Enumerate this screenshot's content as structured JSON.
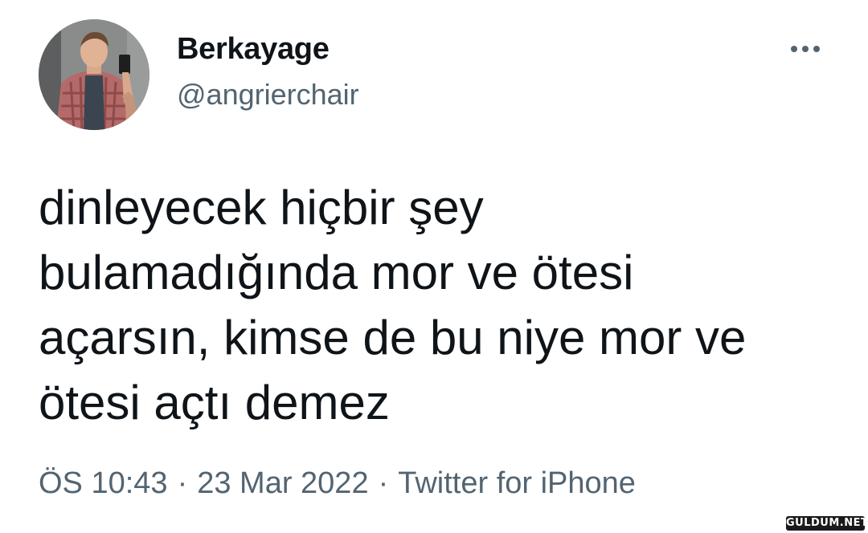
{
  "tweet": {
    "author": {
      "display_name": "Berkayage",
      "handle": "@angrierchair"
    },
    "more_icon": "more-horizontal-icon",
    "text_lines": [
      "dinleyecek hiçbir şey",
      "bulamadığında mor ve ötesi",
      "açarsın, kimse de bu niye mor ve",
      "ötesi açtı demez"
    ],
    "meta": {
      "time": "ÖS 10:43",
      "separator": "·",
      "date": "23 Mar 2022",
      "source": "Twitter for iPhone"
    }
  },
  "watermark": {
    "text": "GULDUM.NET"
  },
  "colors": {
    "text_primary": "#0f1419",
    "text_secondary": "#536471",
    "background": "#ffffff"
  }
}
